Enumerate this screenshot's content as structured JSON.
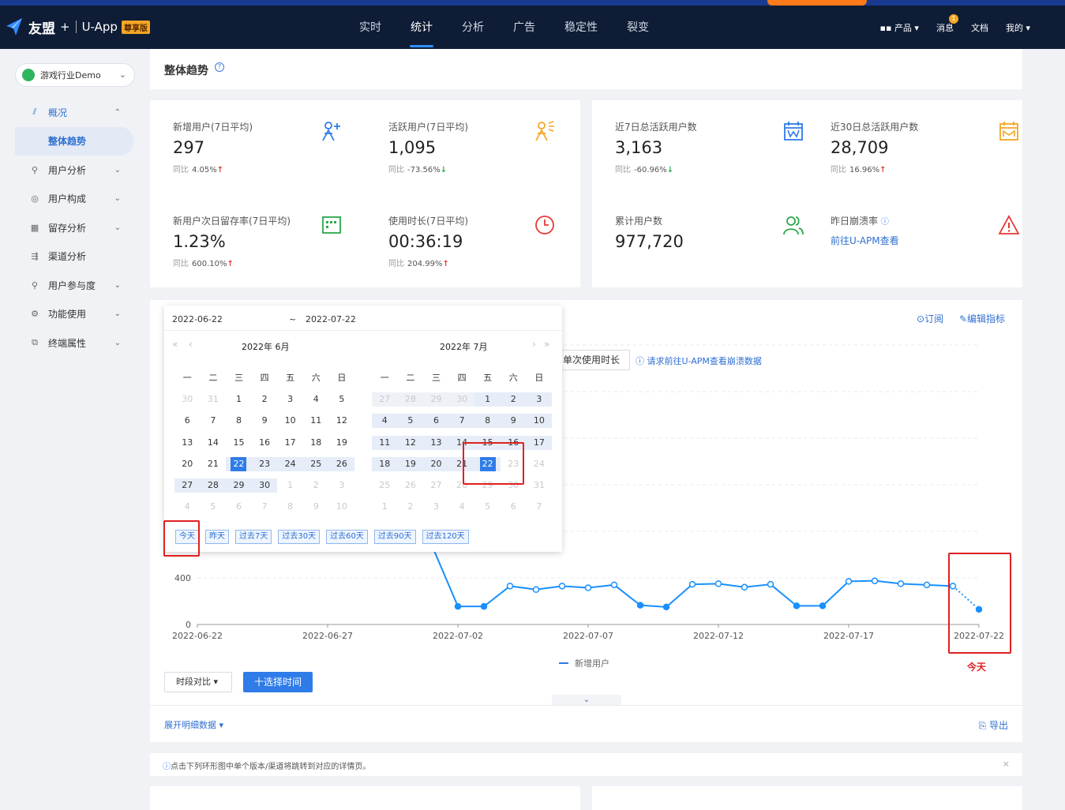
{
  "header": {
    "brand": "友盟",
    "plus": "+",
    "app": "U-App",
    "badge": "尊享版",
    "nav": [
      "实时",
      "统计",
      "分析",
      "广告",
      "稳定性",
      "裂变"
    ],
    "right": {
      "product": "产品 ▾",
      "messages": "消息",
      "message_count": "1",
      "docs": "文档",
      "mine": "我的 ▾"
    }
  },
  "sidebar": {
    "app_name": "游戏行业Demo",
    "items": [
      {
        "label": "概况",
        "icon": "chart-icon"
      },
      {
        "label": "整体趋势"
      },
      {
        "label": "用户分析",
        "icon": "user-analysis-icon"
      },
      {
        "label": "用户构成",
        "icon": "user-composition-icon"
      },
      {
        "label": "留存分析",
        "icon": "retention-icon"
      },
      {
        "label": "渠道分析",
        "icon": "channel-icon"
      },
      {
        "label": "用户参与度",
        "icon": "engagement-icon"
      },
      {
        "label": "功能使用",
        "icon": "feature-icon"
      },
      {
        "label": "终端属性",
        "icon": "terminal-icon"
      }
    ]
  },
  "page": {
    "title": "整体趋势"
  },
  "stats": [
    {
      "label": "新增用户(7日平均)",
      "value": "297",
      "cmp": "同比",
      "pct": "4.05%",
      "dir": "up"
    },
    {
      "label": "活跃用户(7日平均)",
      "value": "1,095",
      "cmp": "同比",
      "pct": "-73.56%",
      "dir": "down"
    },
    {
      "label": "新用户次日留存率(7日平均)",
      "value": "1.23%",
      "cmp": "同比",
      "pct": "600.10%",
      "dir": "up"
    },
    {
      "label": "使用时长(7日平均)",
      "value": "00:36:19",
      "cmp": "同比",
      "pct": "204.99%",
      "dir": "up"
    },
    {
      "label": "近7日总活跃用户数",
      "value": "3,163",
      "cmp": "同比",
      "pct": "-60.96%",
      "dir": "down"
    },
    {
      "label": "近30日总活跃用户数",
      "value": "28,709",
      "cmp": "同比",
      "pct": "16.96%",
      "dir": "up"
    },
    {
      "label": "累计用户数",
      "value": "977,720"
    },
    {
      "label": "昨日崩溃率",
      "link": "前往U-APM查看"
    }
  ],
  "chart_panel": {
    "subscribe": "⊙订阅",
    "edit": "✎编辑指标",
    "metric_tab": "单次使用时长",
    "apm_note": "请求前往U-APM查看崩溃数据",
    "time_compare": "时段对比 ▾",
    "select_time": "十选择时间",
    "expand": "展开明细数据 ▾",
    "export": "导出",
    "collapse": "⌄"
  },
  "datepicker": {
    "start": "2022-06-22",
    "tilde": "~",
    "end": "2022-07-22",
    "left_title": "2022年 6月",
    "right_title": "2022年 7月",
    "weekdays": [
      "一",
      "二",
      "三",
      "四",
      "五",
      "六",
      "日"
    ],
    "quick": [
      "今天",
      "昨天",
      "过去7天",
      "过去30天",
      "过去60天",
      "过去90天",
      "过去120天"
    ]
  },
  "annotation": {
    "today": "今天"
  },
  "notice": {
    "text": "点击下列环形图中单个版本/渠道将跳转到对应的详情页。"
  },
  "chart_data": {
    "type": "line",
    "x": [
      "2022-06-22",
      "2022-06-23",
      "2022-06-24",
      "2022-06-25",
      "2022-06-26",
      "2022-06-27",
      "2022-06-28",
      "2022-06-29",
      "2022-06-30",
      "2022-07-01",
      "2022-07-02",
      "2022-07-03",
      "2022-07-04",
      "2022-07-05",
      "2022-07-06",
      "2022-07-07",
      "2022-07-08",
      "2022-07-09",
      "2022-07-10",
      "2022-07-11",
      "2022-07-12",
      "2022-07-13",
      "2022-07-14",
      "2022-07-15",
      "2022-07-16",
      "2022-07-17",
      "2022-07-18",
      "2022-07-19",
      "2022-07-20",
      "2022-07-21",
      "2022-07-22"
    ],
    "xticks": [
      "2022-06-22",
      "2022-06-27",
      "2022-07-02",
      "2022-07-07",
      "2022-07-12",
      "2022-07-17",
      "2022-07-22"
    ],
    "yticks": [
      0,
      400
    ],
    "ylim": [
      0,
      2000
    ],
    "series": [
      {
        "name": "新增用户",
        "values": [
          null,
          null,
          null,
          null,
          null,
          null,
          null,
          null,
          null,
          680,
          155,
          155,
          330,
          300,
          330,
          315,
          340,
          165,
          150,
          345,
          350,
          320,
          345,
          160,
          160,
          370,
          375,
          350,
          340,
          330,
          130
        ]
      }
    ]
  }
}
